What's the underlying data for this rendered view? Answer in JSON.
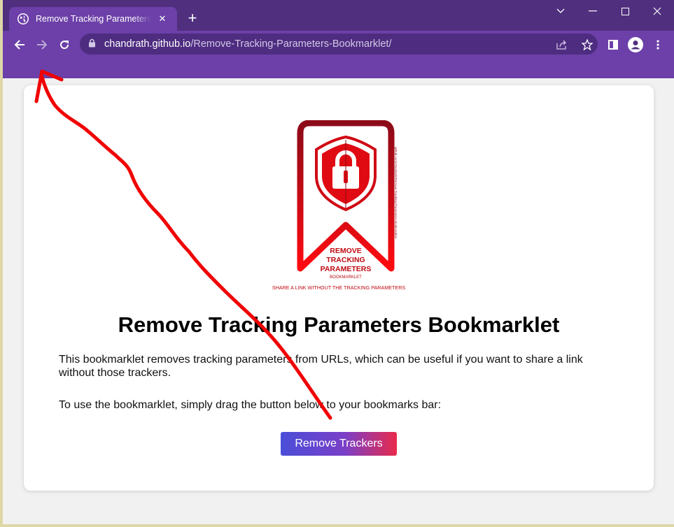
{
  "browser": {
    "tab_title": "Remove Tracking Parameters Bookmarklet",
    "tab_close": "✕",
    "new_tab": "+",
    "url_domain": "chandrath.github.io",
    "url_path": "/Remove-Tracking-Parameters-Bookmarklet/"
  },
  "logo": {
    "line1": "REMOVE",
    "line2": "TRACKING",
    "line3": "PARAMETERS",
    "line4": "BOOKMARKLET",
    "tagline": "SHARE A LINK WITHOUT THE TRACKING PARAMETERS",
    "side_text": "github.com/chandrath/Remove-Tracking-Parameters-Bookmarklet",
    "color": "#e00a12"
  },
  "page": {
    "title": "Remove Tracking Parameters Bookmarklet",
    "para1": "This bookmarklet removes tracking parameters from URLs, which can be useful if you want to share a link without those trackers.",
    "para2": "To use the bookmarklet, simply drag the button below to your bookmarks bar:",
    "button_label": "Remove Trackers"
  },
  "colors": {
    "titlebar": "#50307e",
    "toolbar": "#6c40a8",
    "annotation_arrow": "#f00000"
  }
}
